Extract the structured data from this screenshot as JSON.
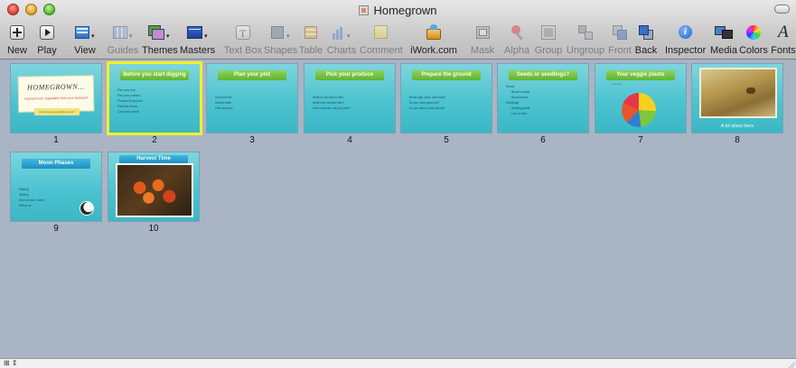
{
  "window": {
    "title": "Homegrown"
  },
  "toolbar": {
    "items": [
      {
        "label": "New",
        "icon": "plus-icon",
        "enabled": true
      },
      {
        "label": "Play",
        "icon": "play-icon",
        "enabled": true
      },
      {
        "label": "View",
        "icon": "view-icon",
        "enabled": true
      },
      {
        "label": "Guides",
        "icon": "guides-icon",
        "enabled": false
      },
      {
        "label": "Themes",
        "icon": "themes-icon",
        "enabled": true
      },
      {
        "label": "Masters",
        "icon": "masters-icon",
        "enabled": true
      },
      {
        "label": "Text Box",
        "icon": "textbox-icon",
        "enabled": false
      },
      {
        "label": "Shapes",
        "icon": "shapes-icon",
        "enabled": false
      },
      {
        "label": "Table",
        "icon": "table-icon",
        "enabled": false
      },
      {
        "label": "Charts",
        "icon": "charts-icon",
        "enabled": false
      },
      {
        "label": "Comment",
        "icon": "comment-icon",
        "enabled": false
      },
      {
        "label": "iWork.com",
        "icon": "iwork-icon",
        "enabled": true
      },
      {
        "label": "Mask",
        "icon": "mask-icon",
        "enabled": false
      },
      {
        "label": "Alpha",
        "icon": "alpha-icon",
        "enabled": false
      },
      {
        "label": "Group",
        "icon": "group-icon",
        "enabled": false
      },
      {
        "label": "Ungroup",
        "icon": "ungroup-icon",
        "enabled": false
      },
      {
        "label": "Front",
        "icon": "front-icon",
        "enabled": false
      },
      {
        "label": "Back",
        "icon": "back-icon",
        "enabled": true
      },
      {
        "label": "Inspector",
        "icon": "inspector-icon",
        "enabled": true
      },
      {
        "label": "Media",
        "icon": "media-icon",
        "enabled": true
      },
      {
        "label": "Colors",
        "icon": "colors-icon",
        "enabled": true
      },
      {
        "label": "Fonts",
        "icon": "fonts-icon",
        "enabled": true
      }
    ]
  },
  "slides": [
    {
      "number": "1",
      "title": "HOMEGROWN...",
      "subtitle": "Harvest fresh vegetables from your backyard",
      "tag": "How does your garden grow?"
    },
    {
      "number": "2",
      "title": "Before you start digging",
      "selected": true,
      "bullets": [
        "Plan your plot",
        "Pick your produce",
        "Prepare the ground",
        "Plant the seeds",
        "Care and nurture"
      ]
    },
    {
      "number": "3",
      "title": "Plan your plot",
      "bullets": [
        "Ground level",
        "Raised beds",
        "Pots and pots"
      ]
    },
    {
      "number": "4",
      "title": "Pick your produce",
      "bullets": [
        "What do you like to eat?",
        "What's the weather like?",
        "How much time do you have?"
      ]
    },
    {
      "number": "5",
      "title": "Prepare the ground",
      "bullets": [
        "Break clay, sand, add mulch",
        "Do you have good soil?",
        "Do you need to add topsoil?"
      ]
    },
    {
      "number": "6",
      "title": "Seeds or seedlings?",
      "bullets": [
        "Seeds",
        "Broad cocktail",
        "Broad leaves",
        "Seedlings",
        "Starting plants",
        "Lots of work"
      ]
    },
    {
      "number": "7",
      "title": "Your veggie plants"
    },
    {
      "number": "8",
      "caption": "A bit about bees"
    },
    {
      "number": "9",
      "title": "Moon Phases",
      "bullets": [
        "Waxing",
        "Waning",
        "Start of each month",
        "Effects of..."
      ]
    },
    {
      "number": "10",
      "title": "Harvest Time"
    }
  ],
  "colors": {
    "selection": "#f1f12a",
    "slide_bg": "#4cc3d0",
    "banner_green": "#5fb432",
    "banner_blue": "#1f8fc2"
  }
}
